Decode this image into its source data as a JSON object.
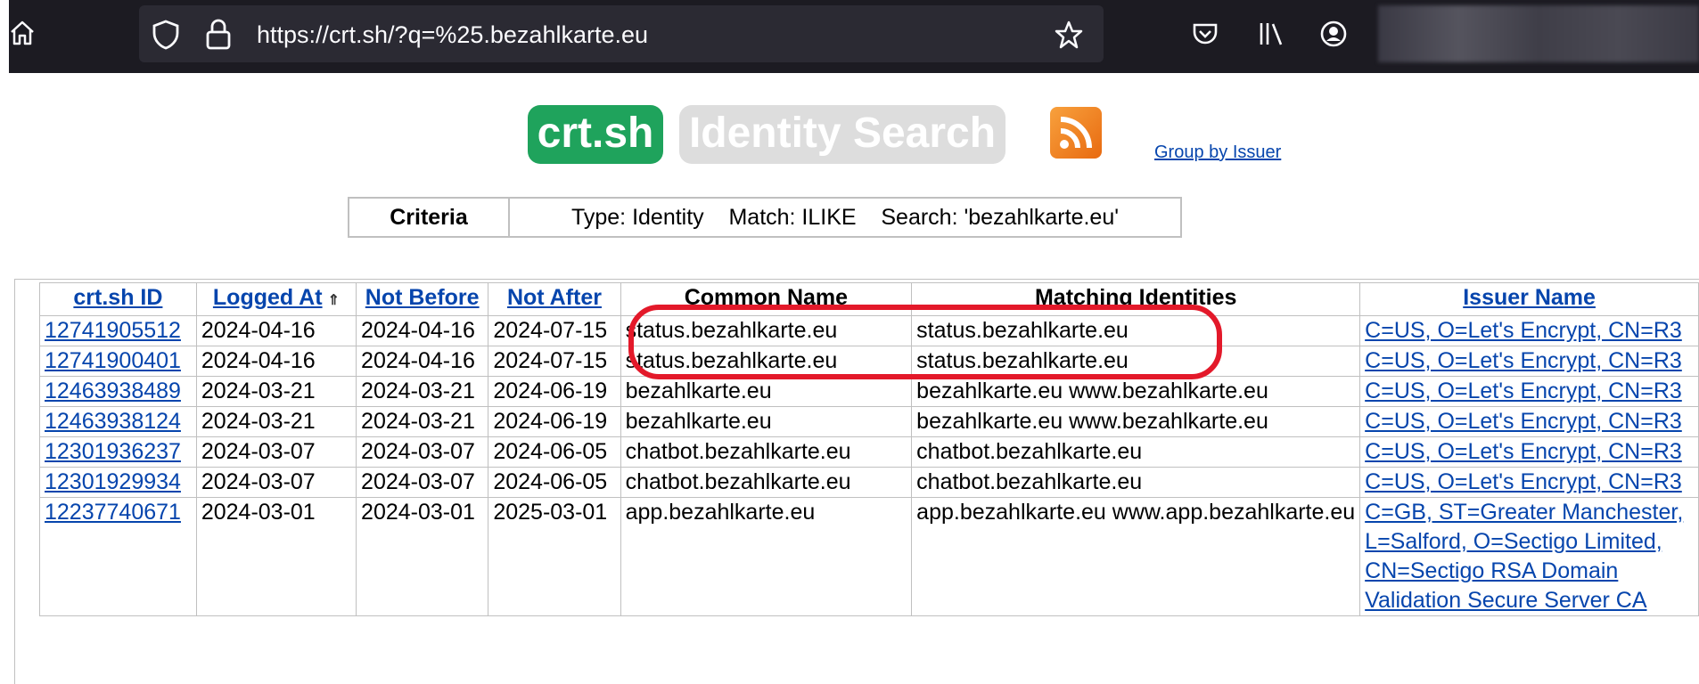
{
  "browser": {
    "url": "https://crt.sh/?q=%25.bezahlkarte.eu",
    "icons": [
      "home-icon",
      "shield-icon",
      "lock-icon",
      "star-icon",
      "pocket-icon",
      "library-icon",
      "account-icon"
    ]
  },
  "header": {
    "logo_primary": "crt.sh",
    "logo_secondary": "Identity Search",
    "rss_icon": "rss-icon",
    "group_link": "Group by Issuer"
  },
  "criteria": {
    "label": "Criteria",
    "value": "Type: Identity    Match: ILIKE    Search: 'bezahlkarte.eu'"
  },
  "table": {
    "columns": [
      "crt.sh ID",
      "Logged At",
      "Not Before",
      "Not After",
      "Common Name",
      "Matching Identities",
      "Issuer Name"
    ],
    "sort_indicator": "⇑",
    "rows": [
      {
        "id": "12741905512",
        "logged": "2024-04-16",
        "before": "2024-04-16",
        "after": "2024-07-15",
        "cn": "status.bezahlkarte.eu",
        "matching": "status.bezahlkarte.eu",
        "issuer": "C=US, O=Let's Encrypt, CN=R3"
      },
      {
        "id": "12741900401",
        "logged": "2024-04-16",
        "before": "2024-04-16",
        "after": "2024-07-15",
        "cn": "status.bezahlkarte.eu",
        "matching": "status.bezahlkarte.eu",
        "issuer": "C=US, O=Let's Encrypt, CN=R3"
      },
      {
        "id": "12463938489",
        "logged": "2024-03-21",
        "before": "2024-03-21",
        "after": "2024-06-19",
        "cn": "bezahlkarte.eu",
        "matching": "bezahlkarte.eu\nwww.bezahlkarte.eu",
        "issuer": "C=US, O=Let's Encrypt, CN=R3"
      },
      {
        "id": "12463938124",
        "logged": "2024-03-21",
        "before": "2024-03-21",
        "after": "2024-06-19",
        "cn": "bezahlkarte.eu",
        "matching": "bezahlkarte.eu\nwww.bezahlkarte.eu",
        "issuer": "C=US, O=Let's Encrypt, CN=R3"
      },
      {
        "id": "12301936237",
        "logged": "2024-03-07",
        "before": "2024-03-07",
        "after": "2024-06-05",
        "cn": "chatbot.bezahlkarte.eu",
        "matching": "chatbot.bezahlkarte.eu",
        "issuer": "C=US, O=Let's Encrypt, CN=R3"
      },
      {
        "id": "12301929934",
        "logged": "2024-03-07",
        "before": "2024-03-07",
        "after": "2024-06-05",
        "cn": "chatbot.bezahlkarte.eu",
        "matching": "chatbot.bezahlkarte.eu",
        "issuer": "C=US, O=Let's Encrypt, CN=R3"
      },
      {
        "id": "12237740671",
        "logged": "2024-03-01",
        "before": "2024-03-01",
        "after": "2025-03-01",
        "cn": "app.bezahlkarte.eu",
        "matching": "app.bezahlkarte.eu\nwww.app.bezahlkarte.eu",
        "issuer": "C=GB, ST=Greater Manchester,\nL=Salford, O=Sectigo Limited,\nCN=Sectigo RSA Domain\nValidation Secure Server CA"
      }
    ]
  },
  "colors": {
    "toolbar_bg": "#1c1b22",
    "logo_green": "#1fa35c",
    "link_blue": "#0645ad",
    "annotation_red": "#e3192a"
  }
}
